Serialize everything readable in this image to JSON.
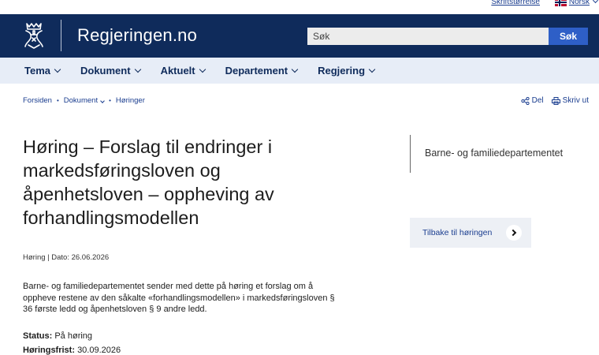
{
  "utility": {
    "font_size_link": "Skriftstørrelse",
    "language_link": "Norsk"
  },
  "header": {
    "site_name": "Regjeringen.no",
    "search_placeholder": "Søk",
    "search_button": "Søk"
  },
  "nav": {
    "items": [
      {
        "label": "Tema"
      },
      {
        "label": "Dokument"
      },
      {
        "label": "Aktuelt"
      },
      {
        "label": "Departement"
      },
      {
        "label": "Regjering"
      }
    ]
  },
  "breadcrumb": {
    "items": [
      "Forsiden",
      "Dokument",
      "Høringer"
    ]
  },
  "tools": {
    "share": "Del",
    "print": "Skriv ut"
  },
  "article": {
    "title": "Høring – Forslag til endringer i markedsføringsloven og åpenhetsloven – oppheving av forhandlingsmodellen",
    "meta": "Høring | Dato: 26.06.2026",
    "intro": "Barne- og familiedepartementet sender med dette på høring et forslag om å oppheve restene av den såkalte «forhandlingsmodellen» i markedsføringsloven § 36 første ledd og åpenhetsloven § 9 andre ledd.",
    "status_label": "Status:",
    "status_value": "På høring",
    "deadline_label": "Høringsfrist:",
    "deadline_value": "30.09.2026"
  },
  "aside": {
    "department": "Barne- og familiedepartementet",
    "back_label": "Tilbake til høringen"
  },
  "colors": {
    "header_bg": "#0f2b5b",
    "nav_bg": "#e7edf7",
    "link": "#1a3d8f",
    "search_button": "#2e5fc7"
  }
}
